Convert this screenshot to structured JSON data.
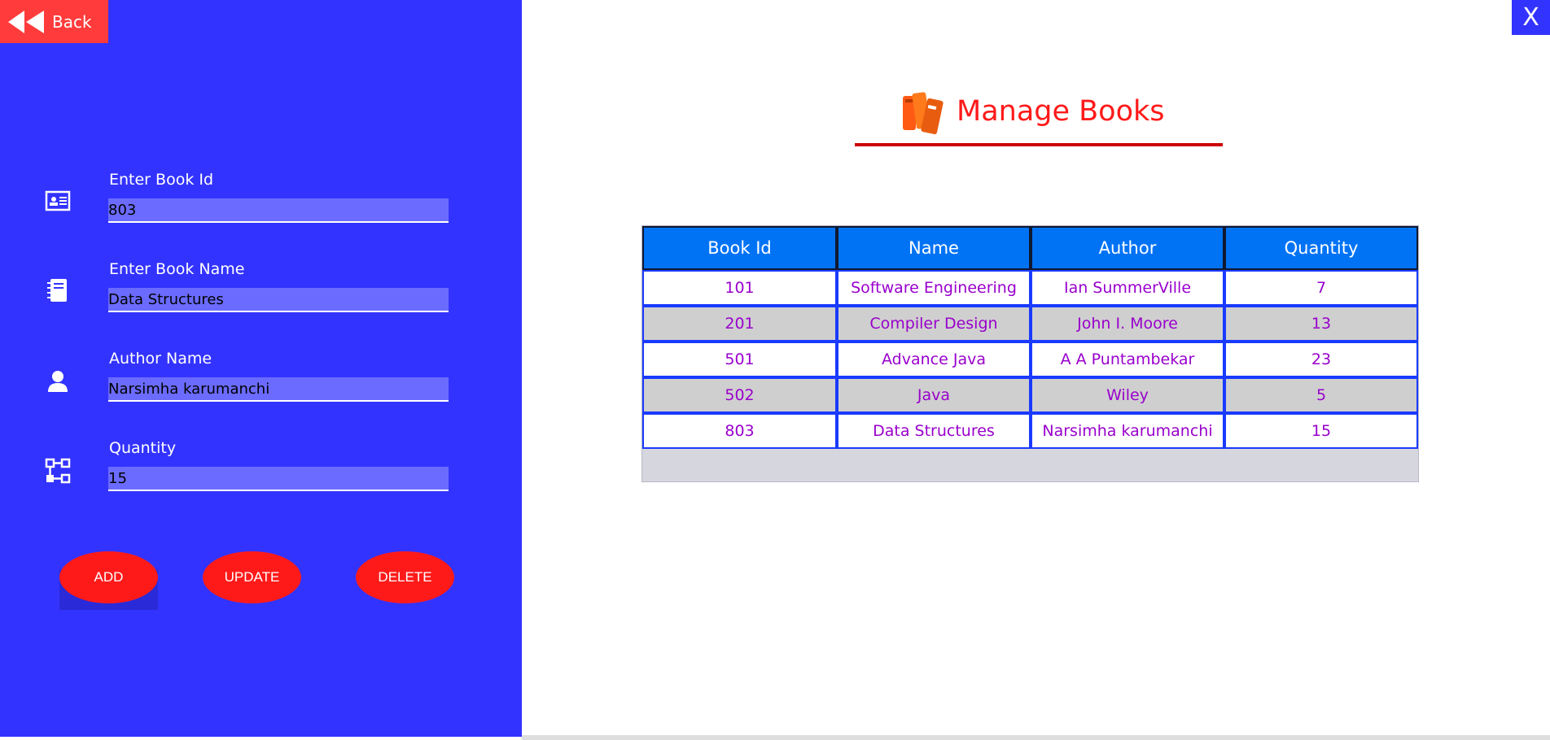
{
  "back": {
    "label": "Back"
  },
  "close": {
    "label": "X"
  },
  "title": "Manage Books",
  "form": {
    "book_id": {
      "label": "Enter Book Id",
      "value": "803"
    },
    "book_name": {
      "label": "Enter Book Name",
      "value": "Data Structures"
    },
    "author": {
      "label": "Author Name",
      "value": "Narsimha karumanchi"
    },
    "quantity": {
      "label": "Quantity",
      "value": "15"
    }
  },
  "buttons": {
    "add": "ADD",
    "update": "UPDATE",
    "delete": "DELETE"
  },
  "table": {
    "headers": [
      "Book Id",
      "Name",
      "Author",
      "Quantity"
    ],
    "rows": [
      [
        "101",
        "Software Engineering",
        "Ian SummerVille",
        "7"
      ],
      [
        "201",
        "Compiler Design",
        "John I. Moore",
        "13"
      ],
      [
        "501",
        "Advance Java",
        "A A Puntambekar",
        "23"
      ],
      [
        "502",
        "Java",
        "Wiley",
        "5"
      ],
      [
        "803",
        "Data Structures",
        "Narsimha karumanchi",
        "15"
      ]
    ]
  },
  "colors": {
    "panel": "#3333ff",
    "accent_red": "#ff1a1a",
    "header_blue": "#0073f5",
    "cell_text": "#9900cc"
  },
  "icons": {
    "back": "rewind-icon",
    "book_id": "id-card-icon",
    "book_name": "notebook-icon",
    "author": "user-icon",
    "quantity": "hierarchy-icon",
    "title": "books-icon"
  }
}
